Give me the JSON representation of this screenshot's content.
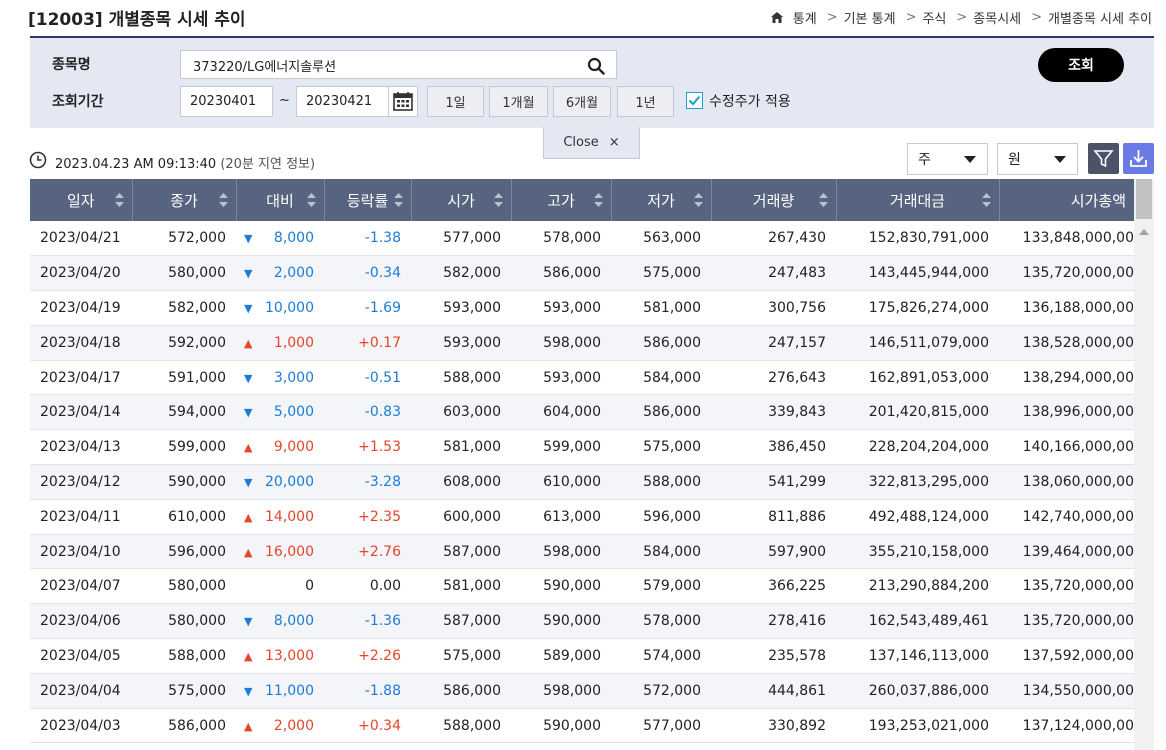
{
  "page": {
    "title": "[12003] 개별종목 시세 추이"
  },
  "breadcrumb": [
    "통계",
    "기본 통계",
    "주식",
    "종목시세",
    "개별종목 시세 추이"
  ],
  "search": {
    "stock_label": "종목명",
    "stock_value": "373220/LG에너지솔루션",
    "period_label": "조회기간",
    "date_from": "20230401",
    "date_to": "20230421",
    "tilde": "~",
    "period_buttons": [
      "1일",
      "1개월",
      "6개월",
      "1년"
    ],
    "adjusted_label": "수정주가 적용",
    "adjusted_checked": true,
    "query_button": "조회",
    "close_label": "Close",
    "close_x": "×"
  },
  "info": {
    "timestamp": "2023.04.23 AM 09:13:40",
    "delay_note": "(20분 지연 정보)",
    "unit_select": "주",
    "currency_select": "원"
  },
  "colors": {
    "up": "#e4452b",
    "down": "#1d7bd4",
    "header_bg": "#57647f"
  },
  "table": {
    "columns": [
      "일자",
      "종가",
      "대비",
      "등락률",
      "시가",
      "고가",
      "저가",
      "거래량",
      "거래대금",
      "시가총액"
    ],
    "rows": [
      {
        "date": "2023/04/21",
        "close": "572,000",
        "dir": "down",
        "diff": "8,000",
        "rate": "-1.38",
        "open": "577,000",
        "high": "578,000",
        "low": "563,000",
        "volume": "267,430",
        "value": "152,830,791,000",
        "cap": "133,848,000,00"
      },
      {
        "date": "2023/04/20",
        "close": "580,000",
        "dir": "down",
        "diff": "2,000",
        "rate": "-0.34",
        "open": "582,000",
        "high": "586,000",
        "low": "575,000",
        "volume": "247,483",
        "value": "143,445,944,000",
        "cap": "135,720,000,00"
      },
      {
        "date": "2023/04/19",
        "close": "582,000",
        "dir": "down",
        "diff": "10,000",
        "rate": "-1.69",
        "open": "593,000",
        "high": "593,000",
        "low": "581,000",
        "volume": "300,756",
        "value": "175,826,274,000",
        "cap": "136,188,000,00"
      },
      {
        "date": "2023/04/18",
        "close": "592,000",
        "dir": "up",
        "diff": "1,000",
        "rate": "+0.17",
        "open": "593,000",
        "high": "598,000",
        "low": "586,000",
        "volume": "247,157",
        "value": "146,511,079,000",
        "cap": "138,528,000,00"
      },
      {
        "date": "2023/04/17",
        "close": "591,000",
        "dir": "down",
        "diff": "3,000",
        "rate": "-0.51",
        "open": "588,000",
        "high": "593,000",
        "low": "584,000",
        "volume": "276,643",
        "value": "162,891,053,000",
        "cap": "138,294,000,00"
      },
      {
        "date": "2023/04/14",
        "close": "594,000",
        "dir": "down",
        "diff": "5,000",
        "rate": "-0.83",
        "open": "603,000",
        "high": "604,000",
        "low": "586,000",
        "volume": "339,843",
        "value": "201,420,815,000",
        "cap": "138,996,000,00"
      },
      {
        "date": "2023/04/13",
        "close": "599,000",
        "dir": "up",
        "diff": "9,000",
        "rate": "+1.53",
        "open": "581,000",
        "high": "599,000",
        "low": "575,000",
        "volume": "386,450",
        "value": "228,204,204,000",
        "cap": "140,166,000,00"
      },
      {
        "date": "2023/04/12",
        "close": "590,000",
        "dir": "down",
        "diff": "20,000",
        "rate": "-3.28",
        "open": "608,000",
        "high": "610,000",
        "low": "588,000",
        "volume": "541,299",
        "value": "322,813,295,000",
        "cap": "138,060,000,00"
      },
      {
        "date": "2023/04/11",
        "close": "610,000",
        "dir": "up",
        "diff": "14,000",
        "rate": "+2.35",
        "open": "600,000",
        "high": "613,000",
        "low": "596,000",
        "volume": "811,886",
        "value": "492,488,124,000",
        "cap": "142,740,000,00"
      },
      {
        "date": "2023/04/10",
        "close": "596,000",
        "dir": "up",
        "diff": "16,000",
        "rate": "+2.76",
        "open": "587,000",
        "high": "598,000",
        "low": "584,000",
        "volume": "597,900",
        "value": "355,210,158,000",
        "cap": "139,464,000,00"
      },
      {
        "date": "2023/04/07",
        "close": "580,000",
        "dir": "flat",
        "diff": "0",
        "rate": "0.00",
        "open": "581,000",
        "high": "590,000",
        "low": "579,000",
        "volume": "366,225",
        "value": "213,290,884,200",
        "cap": "135,720,000,00"
      },
      {
        "date": "2023/04/06",
        "close": "580,000",
        "dir": "down",
        "diff": "8,000",
        "rate": "-1.36",
        "open": "587,000",
        "high": "590,000",
        "low": "578,000",
        "volume": "278,416",
        "value": "162,543,489,461",
        "cap": "135,720,000,00"
      },
      {
        "date": "2023/04/05",
        "close": "588,000",
        "dir": "up",
        "diff": "13,000",
        "rate": "+2.26",
        "open": "575,000",
        "high": "589,000",
        "low": "574,000",
        "volume": "235,578",
        "value": "137,146,113,000",
        "cap": "137,592,000,00"
      },
      {
        "date": "2023/04/04",
        "close": "575,000",
        "dir": "down",
        "diff": "11,000",
        "rate": "-1.88",
        "open": "586,000",
        "high": "598,000",
        "low": "572,000",
        "volume": "444,861",
        "value": "260,037,886,000",
        "cap": "134,550,000,00"
      },
      {
        "date": "2023/04/03",
        "close": "586,000",
        "dir": "up",
        "diff": "2,000",
        "rate": "+0.34",
        "open": "588,000",
        "high": "590,000",
        "low": "577,000",
        "volume": "330,892",
        "value": "193,253,021,000",
        "cap": "137,124,000,00"
      }
    ]
  }
}
